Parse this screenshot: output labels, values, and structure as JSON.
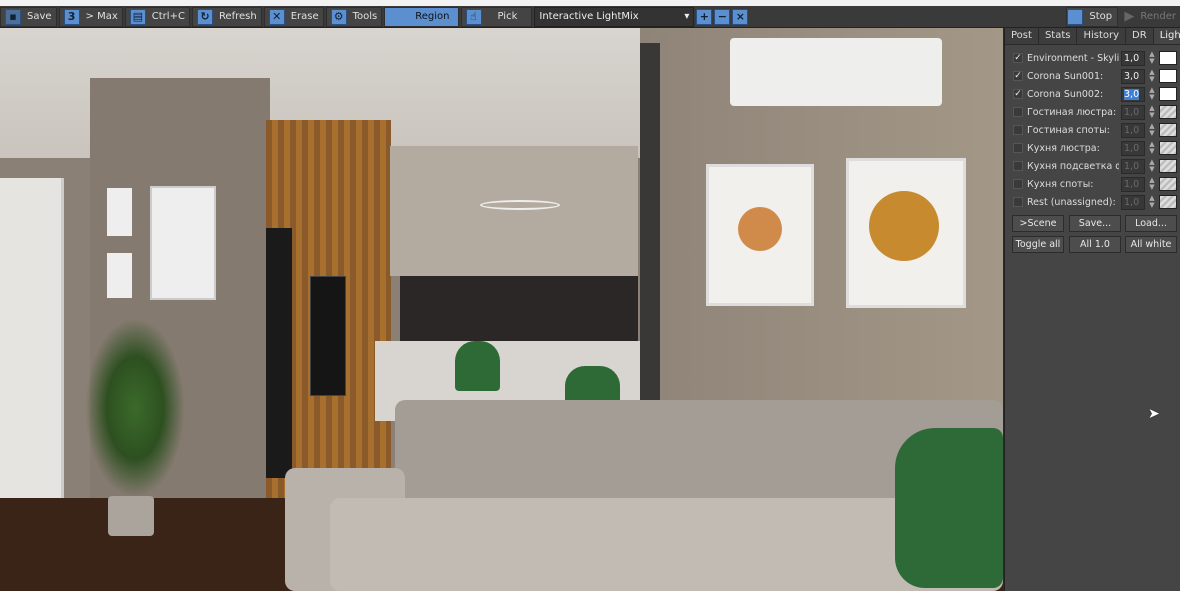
{
  "toolbar": {
    "save": "Save",
    "max": "> Max",
    "copy": "Ctrl+C",
    "refresh": "Refresh",
    "erase": "Erase",
    "tools": "Tools",
    "region": "Region",
    "pick": "Pick",
    "lightmix_select": "Interactive LightMix",
    "stop": "Stop",
    "render": "Render"
  },
  "panel": {
    "tabs": [
      "Post",
      "Stats",
      "History",
      "DR",
      "LightMix"
    ],
    "active_tab": "LightMix",
    "lights": [
      {
        "checked": true,
        "label": "Environment - Skylight",
        "value": "1,0",
        "color": "#ffffff"
      },
      {
        "checked": true,
        "label": "Corona Sun001:",
        "value": "3,0",
        "color": "#ffffff"
      },
      {
        "checked": true,
        "label": "Corona Sun002:",
        "value": "3,0",
        "color": "#ffffff"
      },
      {
        "checked": false,
        "label": "Гостиная люстра:",
        "value": "1,0"
      },
      {
        "checked": false,
        "label": "Гостиная споты:",
        "value": "1,0"
      },
      {
        "checked": false,
        "label": "Кухня люстра:",
        "value": "1,0"
      },
      {
        "checked": false,
        "label": "Кухня подсветка фасадов",
        "value": "1,0"
      },
      {
        "checked": false,
        "label": "Кухня споты:",
        "value": "1,0"
      },
      {
        "checked": false,
        "label": "Rest (unassigned):",
        "value": "1,0"
      }
    ],
    "buttons": {
      "scene": ">Scene",
      "save": "Save...",
      "load": "Load...",
      "toggle": "Toggle all",
      "all1": "All 1.0",
      "allwhite": "All white"
    }
  },
  "colors": {
    "accent": "#5b8fd0",
    "panel_bg": "#454545",
    "toolbar_bg": "#3a3a3a"
  }
}
